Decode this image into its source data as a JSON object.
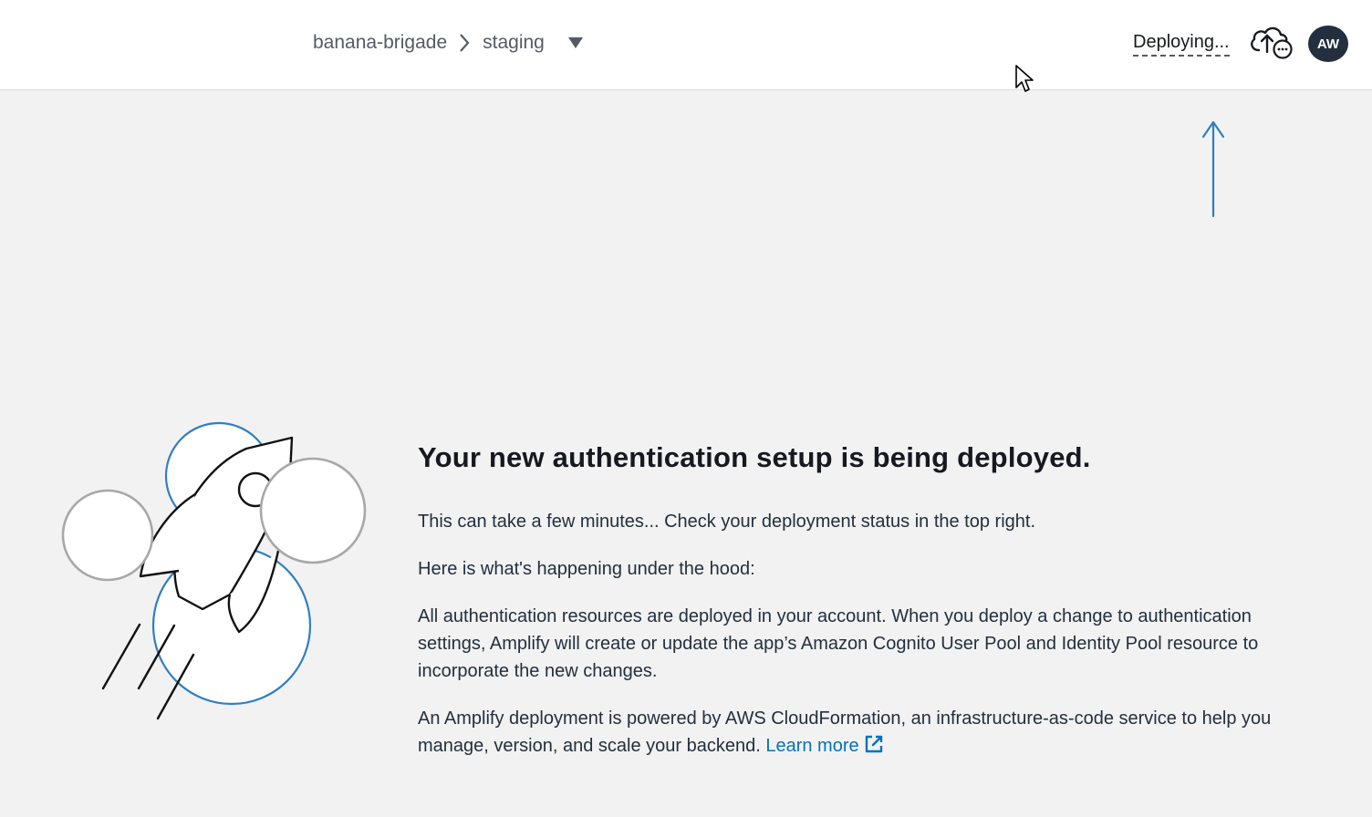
{
  "header": {
    "breadcrumb": {
      "app": "banana-brigade",
      "environment": "staging"
    },
    "deploy_status": "Deploying...",
    "avatar_initials": "AW",
    "icons": {
      "separator": "chevron-right-icon",
      "env_dropdown": "caret-down-icon",
      "deploy": "cloud-upload-pending-icon"
    }
  },
  "main": {
    "headline": "Your new authentication setup is being deployed.",
    "intro": "This can take a few minutes... Check your deployment status in the top right.",
    "under_hood_heading": "Here is what's happening under the hood:",
    "details": "All authentication resources are deployed in your account. When you deploy a change to authentication settings, Amplify will create or update the app’s Amazon Cognito User Pool and Identity Pool resource to incorporate the new changes.",
    "cloudformation_text": "An Amplify deployment is powered by AWS CloudFormation, an infrastructure-as-code service to help you manage, version, and scale your backend.",
    "learn_more": "Learn more",
    "illustration": "rocket-launch-illustration"
  },
  "colors": {
    "accent": "#0073bb",
    "avatar_bg": "#232f3e",
    "page_bg": "#f2f2f2",
    "illustration_blue": "#2f7ec1"
  }
}
